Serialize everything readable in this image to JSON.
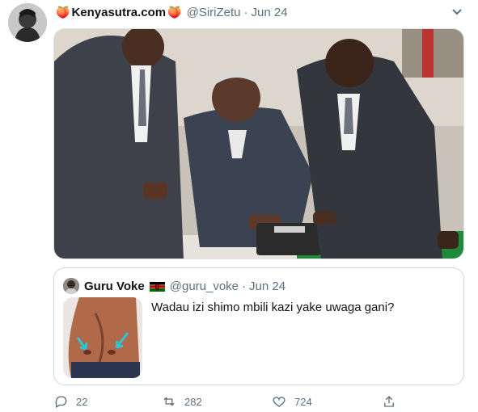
{
  "tweet": {
    "emoji_left": "🍑",
    "name": "Kenyasutra.com",
    "emoji_right": "🍑",
    "handle": "@SiriZetu",
    "dot": "·",
    "date": "Jun 24",
    "menu_icon": "chevron-down-icon"
  },
  "quoted": {
    "name": "Guru Voke",
    "flag": "kenya-flag-icon",
    "handle": "@guru_voke",
    "dot": "·",
    "date": "Jun 24",
    "text": "Wadau izi shimo mbili kazi yake uwaga gani?"
  },
  "actions": {
    "replies": "22",
    "retweets": "282",
    "likes": "724",
    "reply_icon": "reply-icon",
    "retweet_icon": "retweet-icon",
    "like_icon": "heart-icon",
    "share_icon": "share-icon"
  },
  "colors": {
    "text_primary": "#0f1419",
    "text_secondary": "#5b7083",
    "border": "#cfd9de",
    "accent_cyan": "#2ec4d6"
  }
}
